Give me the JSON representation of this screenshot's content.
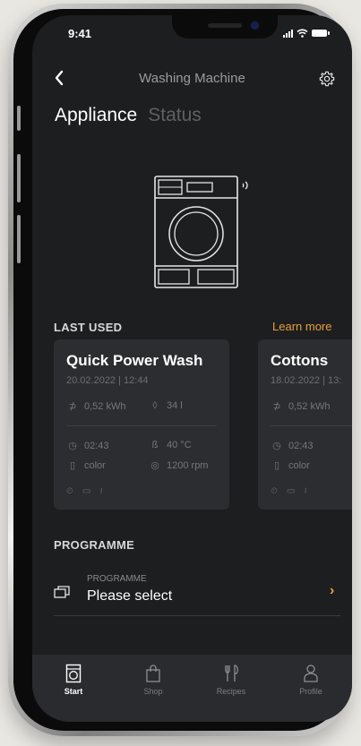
{
  "status_bar": {
    "time": "9:41"
  },
  "header": {
    "back_icon": "chevron-left-icon",
    "title": "Washing Machine",
    "settings_icon": "gear-icon"
  },
  "tabs": [
    {
      "label": "Appliance",
      "active": true
    },
    {
      "label": "Status",
      "active": false
    }
  ],
  "last_used": {
    "heading": "LAST USED",
    "link": "Learn more",
    "link_color": "#e8a133",
    "cards": [
      {
        "title": "Quick Power Wash",
        "date": "20.02.2022 | 12:44",
        "energy": "0,52 kWh",
        "water": "34 l",
        "duration": "02:43",
        "temperature": "40 °C",
        "fabric": "color",
        "spin": "1200 rpm"
      },
      {
        "title": "Cottons",
        "date": "18.02.2022 | 13:",
        "energy": "0,52 kWh",
        "duration": "02:43",
        "fabric": "color"
      }
    ]
  },
  "programme": {
    "heading": "PROGRAMME",
    "label": "PROGRAMME",
    "value": "Please select",
    "chevron": "›"
  },
  "bottom_nav": [
    {
      "label": "Start",
      "icon": "washing-machine-icon",
      "active": true
    },
    {
      "label": "Shop",
      "icon": "shopping-bag-icon",
      "active": false
    },
    {
      "label": "Recipes",
      "icon": "cutlery-icon",
      "active": false
    },
    {
      "label": "Profile",
      "icon": "person-icon",
      "active": false
    }
  ]
}
